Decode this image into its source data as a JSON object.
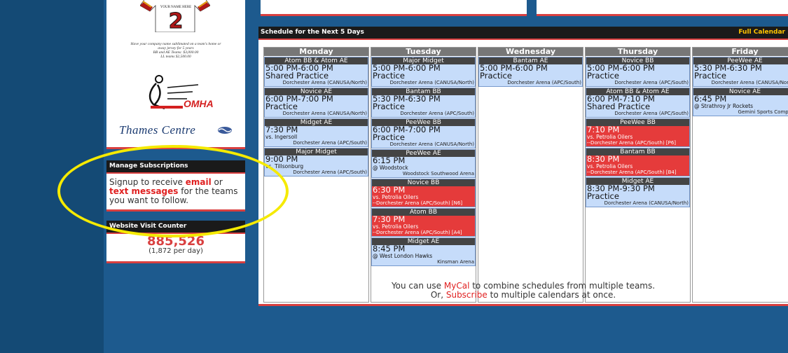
{
  "sponsor": {
    "jersey_name": "YOUR NAME HERE",
    "jersey_number": "2",
    "ad_lines": [
      "Have your company name sublimated on a team's home or",
      "away jersey for 5 years",
      "BB and AE Teams: $3,000.00",
      "LL teams $2,500.00"
    ],
    "omha": "OMHA",
    "thames": "Thames Centre"
  },
  "subscriptions": {
    "title": "Manage Subscriptions",
    "text1": "Signup to receive ",
    "email": "email",
    "text2": " or ",
    "text_messages": "text messages",
    "text3": " for the teams you want to follow."
  },
  "counter": {
    "title": "Website Visit Counter",
    "count": "885,526",
    "per_day": "(1,872 per day)"
  },
  "schedule": {
    "title": "Schedule for the Next 5 Days",
    "full_calendar": "Full Calendar",
    "days": [
      {
        "name": "Monday",
        "events": [
          {
            "team": "Atom BB & Atom AE",
            "time": "5:00 PM-6:00 PM",
            "desc": "Shared Practice",
            "loc": "Dorchester Arena (CANUSA/North)",
            "game": false
          },
          {
            "team": "Novice AE",
            "time": "6:00 PM-7:00 PM",
            "desc": "Practice",
            "loc": "Dorchester Arena (CANUSA/North)",
            "game": false
          },
          {
            "team": "Midget AE",
            "time": "7:30 PM",
            "opp": "vs. Ingersoll",
            "loc": "Dorchester Arena (APC/South)",
            "game": false
          },
          {
            "team": "Major Midget",
            "time": "9:00 PM",
            "opp": "vs. Tillsonburg",
            "loc": "Dorchester Arena (APC/South)",
            "game": false
          }
        ]
      },
      {
        "name": "Tuesday",
        "events": [
          {
            "team": "Major Midget",
            "time": "5:00 PM-6:00 PM",
            "desc": "Practice",
            "loc": "Dorchester Arena (CANUSA/North)",
            "game": false
          },
          {
            "team": "Bantam BB",
            "time": "5:30 PM-6:30 PM",
            "desc": "Practice",
            "loc": "Dorchester Arena (APC/South)",
            "game": false
          },
          {
            "team": "PeeWee BB",
            "time": "6:00 PM-7:00 PM",
            "desc": "Practice",
            "loc": "Dorchester Arena (CANUSA/North)",
            "game": false
          },
          {
            "team": "PeeWee AE",
            "time": "6:15 PM",
            "opp": "@ Woodstock",
            "loc": "Woodstock Southwood Arena",
            "game": false
          },
          {
            "team": "Novice BB",
            "time": "6:30 PM",
            "opp": "vs. Petrolia Oilers",
            "loc": "--Dorchester Arena (APC/South) [N6]",
            "game": true
          },
          {
            "team": "Atom BB",
            "time": "7:30 PM",
            "opp": "vs. Petrolia Oilers",
            "loc": "--Dorchester Arena (APC/South) [A4]",
            "game": true
          },
          {
            "team": "Midget AE",
            "time": "8:45 PM",
            "opp": "@ West London Hawks",
            "loc": "Kinsman Arena",
            "game": false
          }
        ]
      },
      {
        "name": "Wednesday",
        "events": [
          {
            "team": "Bantam AE",
            "time": "5:00 PM-6:00 PM",
            "desc": "Practice",
            "loc": "Dorchester Arena (APC/South)",
            "game": false
          }
        ]
      },
      {
        "name": "Thursday",
        "events": [
          {
            "team": "Novice BB",
            "time": "5:00 PM-6:00 PM",
            "desc": "Practice",
            "loc": "Dorchester Arena (APC/South)",
            "game": false
          },
          {
            "team": "Atom BB & Atom AE",
            "time": "6:00 PM-7:10 PM",
            "desc": "Shared Practice",
            "loc": "Dorchester Arena (APC/South)",
            "game": false
          },
          {
            "team": "PeeWee BB",
            "time": "7:10 PM",
            "opp": "vs. Petrolia Oilers",
            "loc": "--Dorchester Arena (APC/South) [P6]",
            "game": true
          },
          {
            "team": "Bantam BB",
            "time": "8:30 PM",
            "opp": "vs. Petrolia Oilers",
            "loc": "--Dorchester Arena (APC/South) [B4]",
            "game": true
          },
          {
            "team": "Midget AE",
            "time": "8:30 PM-9:30 PM",
            "desc": "Practice",
            "loc": "Dorchester Arena (CANUSA/North)",
            "game": false
          }
        ]
      },
      {
        "name": "Friday",
        "events": [
          {
            "team": "PeeWee AE",
            "time": "5:30 PM-6:30 PM",
            "desc": "Practice",
            "loc": "Dorchester Arena (CANUSA/North)",
            "game": false
          },
          {
            "team": "Novice AE",
            "time": "6:45 PM",
            "opp": "@ Strathroy Jr Rockets",
            "loc": "Gemini Sports Complex",
            "game": false
          }
        ]
      }
    ],
    "footer": {
      "l1a": "You can use ",
      "mycal": "MyCal",
      "l1b": " to combine schedules from multiple teams.",
      "l2a": "Or, ",
      "subscribe": "Subscribe",
      "l2b": " to multiple calendars at once."
    }
  },
  "colors": {
    "highlight_ring": "#f5ea00",
    "accent": "#d94040",
    "game": "#e53b3b",
    "practice": "#c6dcfa"
  }
}
